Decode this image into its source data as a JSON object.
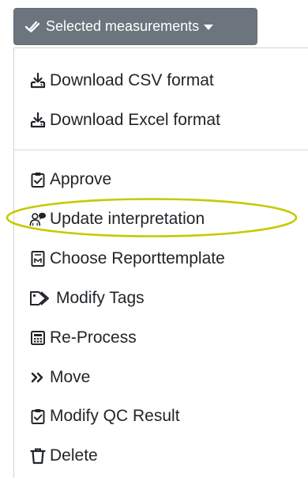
{
  "toggle": {
    "label": "Selected measurements",
    "icon": "double-check-icon",
    "caret_icon": "caret-down-icon"
  },
  "menu": {
    "download_items": [
      {
        "label": "Download CSV format",
        "icon": "download-tray-icon"
      },
      {
        "label": "Download Excel format",
        "icon": "download-tray-icon"
      }
    ],
    "action_items": [
      {
        "label": "Approve",
        "icon": "clipboard-check-icon"
      },
      {
        "label": "Update interpretation",
        "icon": "user-comment-icon",
        "highlighted": true
      },
      {
        "label": "Choose Reporttemplate",
        "icon": "report-file-icon"
      },
      {
        "label": "Modify Tags",
        "icon": "tags-icon"
      },
      {
        "label": "Re-Process",
        "icon": "calculator-icon"
      },
      {
        "label": "Move",
        "icon": "double-chevron-right-icon"
      },
      {
        "label": "Modify QC Result",
        "icon": "clipboard-check-icon"
      },
      {
        "label": "Delete",
        "icon": "trash-icon"
      }
    ]
  },
  "colors": {
    "toggle_bg": "#6c757d",
    "highlight_ring": "#c8c800",
    "text": "#212529"
  }
}
